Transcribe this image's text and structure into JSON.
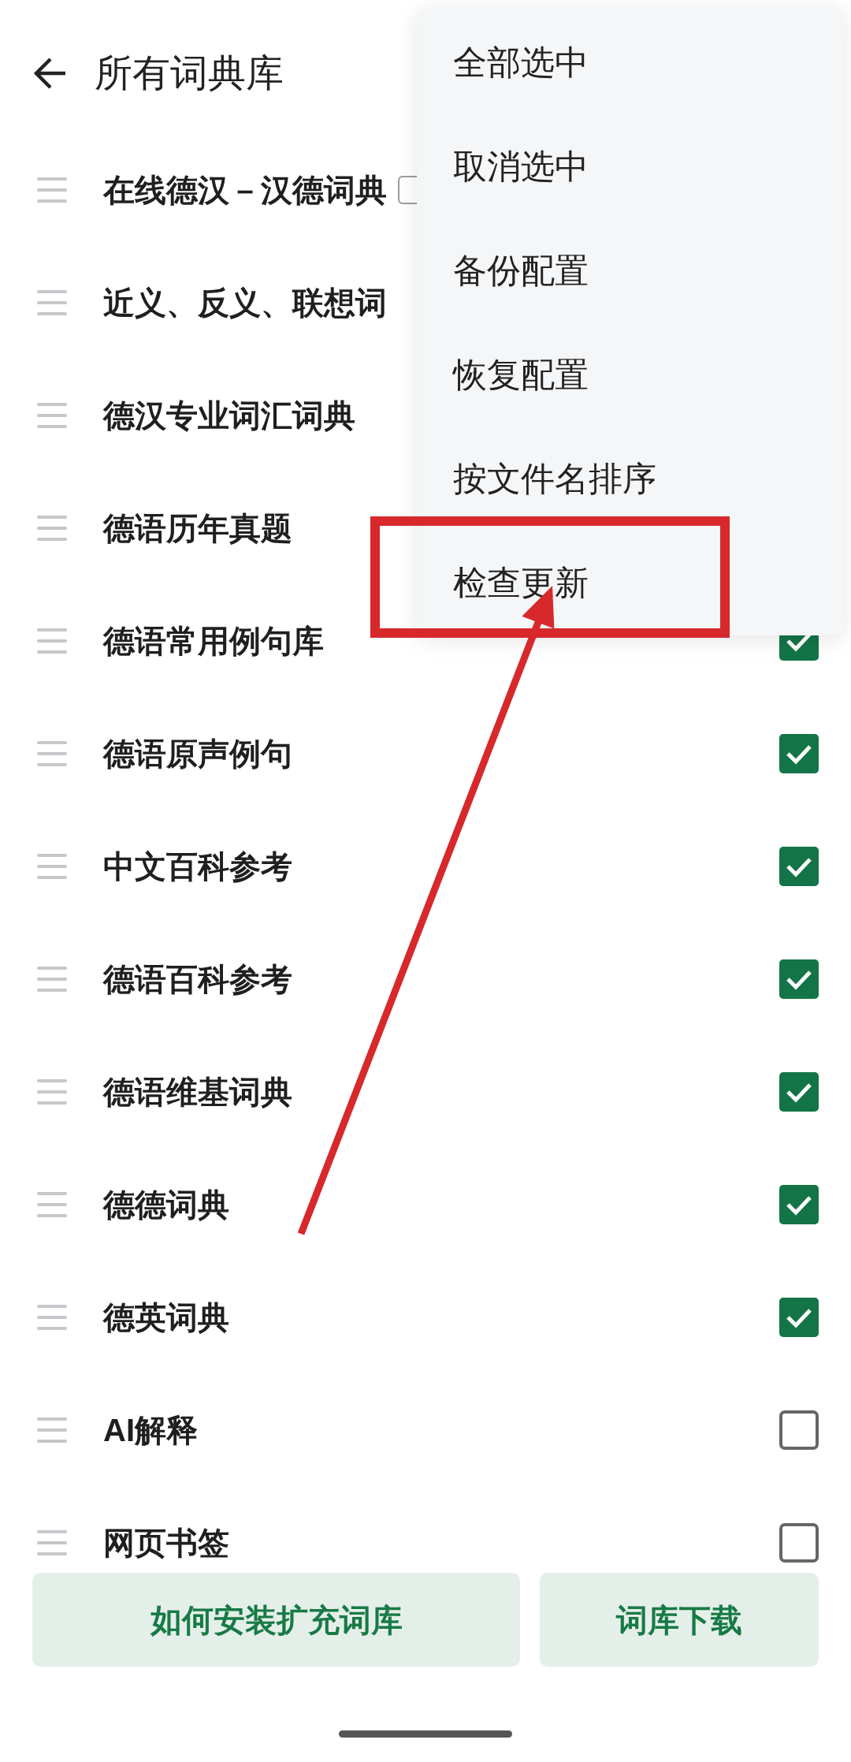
{
  "header": {
    "title": "所有词典库"
  },
  "dictionaries": [
    {
      "name": "在线德汉－汉德词典",
      "tag": true
    },
    {
      "name": "近义、反义、联想词",
      "tag": false
    },
    {
      "name": "德汉专业词汇词典",
      "tag": false
    },
    {
      "name": "德语历年真题",
      "tag": false
    },
    {
      "name": "德语常用例句库",
      "tag": false,
      "checked": true
    },
    {
      "name": "德语原声例句",
      "tag": false,
      "checked": true
    },
    {
      "name": "中文百科参考",
      "tag": false,
      "checked": true
    },
    {
      "name": "德语百科参考",
      "tag": false,
      "checked": true
    },
    {
      "name": "德语维基词典",
      "tag": false,
      "checked": true
    },
    {
      "name": "德德词典",
      "tag": false,
      "checked": true
    },
    {
      "name": "德英词典",
      "tag": false,
      "checked": true
    },
    {
      "name": "AI解释",
      "tag": false,
      "checked": false
    },
    {
      "name": "网页书签",
      "tag": false,
      "checked": false
    }
  ],
  "buttons": [
    "如何安装扩充词库",
    "词库下载"
  ],
  "menu": {
    "items": [
      {
        "label": "全部选中",
        "highlighted": false
      },
      {
        "label": "取消选中",
        "highlighted": false
      },
      {
        "label": "备份配置",
        "highlighted": false
      },
      {
        "label": "恢复配置",
        "highlighted": false
      },
      {
        "label": "按文件名排序",
        "highlighted": false
      },
      {
        "label": "检查更新",
        "highlighted": true
      }
    ]
  }
}
